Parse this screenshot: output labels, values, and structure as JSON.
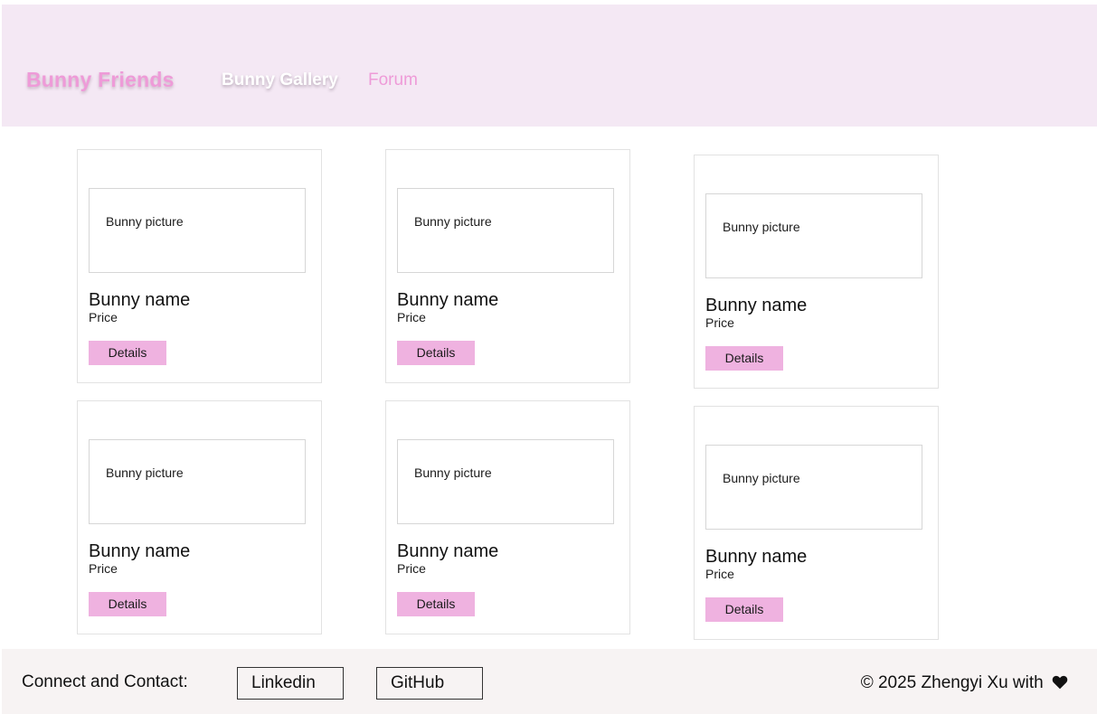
{
  "header": {
    "brand": "Bunny Friends",
    "nav": {
      "gallery": "Bunny Gallery",
      "forum": "Forum"
    }
  },
  "colors": {
    "header_bg": "#f4e8f4",
    "accent_pink": "#ee9bd8",
    "button_pink": "#efb2e0",
    "footer_bg": "#f7f3f3"
  },
  "cards": [
    {
      "picture": "Bunny picture",
      "name": "Bunny name",
      "price": "Price",
      "details": "Details"
    },
    {
      "picture": "Bunny picture",
      "name": "Bunny name",
      "price": "Price",
      "details": "Details"
    },
    {
      "picture": "Bunny picture",
      "name": "Bunny name",
      "price": "Price",
      "details": "Details"
    },
    {
      "picture": "Bunny picture",
      "name": "Bunny name",
      "price": "Price",
      "details": "Details"
    },
    {
      "picture": "Bunny picture",
      "name": "Bunny name",
      "price": "Price",
      "details": "Details"
    },
    {
      "picture": "Bunny picture",
      "name": "Bunny name",
      "price": "Price",
      "details": "Details"
    }
  ],
  "footer": {
    "label": "Connect and Contact:",
    "linkedin": "Linkedin",
    "github": "GitHub",
    "copyright": "© 2025 Zhengyi Xu with",
    "heart_icon": "heart-icon"
  }
}
